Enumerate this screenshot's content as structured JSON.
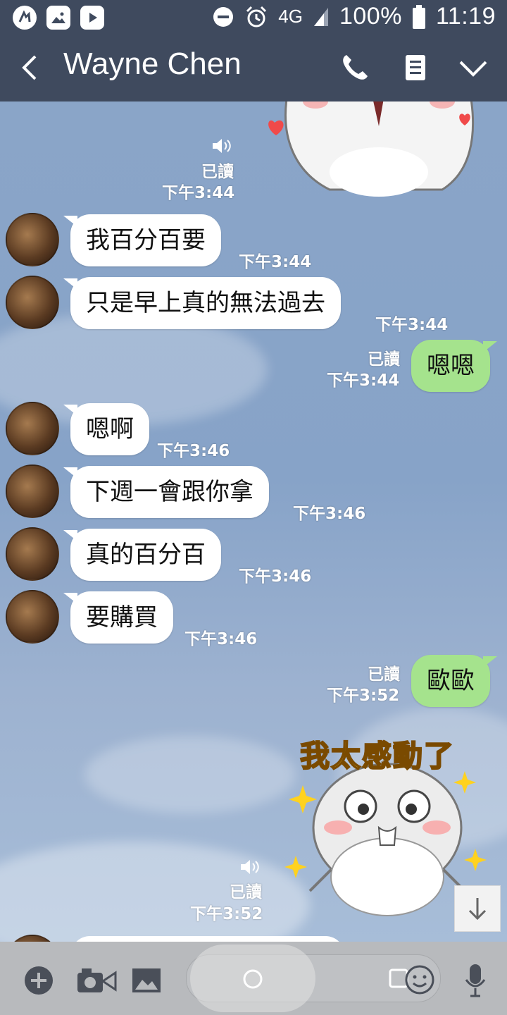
{
  "status_bar": {
    "signal_label": "4G",
    "battery_text": "100%",
    "time": "11:19"
  },
  "header": {
    "title": "Wayne Chen"
  },
  "messages": [
    {
      "side": "out",
      "type": "sticker",
      "read": "已讀",
      "time": "下午3:44"
    },
    {
      "side": "in",
      "text": "我百分百要",
      "time": "下午3:44"
    },
    {
      "side": "in",
      "text": "只是早上真的無法過去",
      "time": "下午3:44"
    },
    {
      "side": "out",
      "text": "嗯嗯",
      "read": "已讀",
      "time": "下午3:44"
    },
    {
      "side": "in",
      "text": "嗯啊",
      "time": "下午3:46"
    },
    {
      "side": "in",
      "text": "下週一會跟你拿",
      "time": "下午3:46"
    },
    {
      "side": "in",
      "text": "真的百分百",
      "time": "下午3:46"
    },
    {
      "side": "in",
      "text": "要購買",
      "time": "下午3:46"
    },
    {
      "side": "out",
      "text": "歐歐",
      "read": "已讀",
      "time": "下午3:52"
    },
    {
      "side": "out",
      "type": "sticker",
      "caption": "我太感動了",
      "read": "已讀",
      "time": "下午3:52"
    }
  ],
  "colors": {
    "header_bg": "#3f4a5e",
    "chat_bg": "#8aa5c8",
    "bubble_out": "#a5e38d",
    "bubble_in": "#ffffff"
  },
  "icons": {
    "status_left": [
      "app-icon",
      "gallery-icon",
      "video-icon"
    ],
    "status_right": [
      "dnd-icon",
      "alarm-icon",
      "signal-icon",
      "battery-icon"
    ],
    "header": [
      "back-icon",
      "phone-icon",
      "notes-icon",
      "chevron-down-icon"
    ],
    "input_bar": [
      "plus-icon",
      "camera-icon",
      "image-icon",
      "emoji-icon",
      "mic-icon"
    ]
  }
}
